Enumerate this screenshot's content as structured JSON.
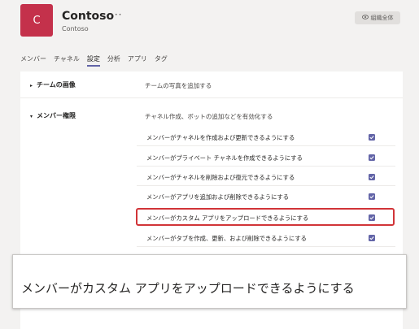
{
  "team": {
    "avatar_letter": "C",
    "name": "Contoso",
    "more": "···",
    "subtitle": "Contoso",
    "org_badge": "組織全体"
  },
  "tabs": [
    {
      "label": "メンバー",
      "active": false
    },
    {
      "label": "チャネル",
      "active": false
    },
    {
      "label": "設定",
      "active": true
    },
    {
      "label": "分析",
      "active": false
    },
    {
      "label": "アプリ",
      "active": false
    },
    {
      "label": "タグ",
      "active": false
    }
  ],
  "sections": [
    {
      "title": "チームの画像",
      "description": "チームの写真を追加する",
      "expanded": false
    },
    {
      "title": "メンバー権限",
      "description": "チャネル作成、ボットの追加などを有効化する",
      "expanded": true
    }
  ],
  "permissions": [
    {
      "label": "メンバーがチャネルを作成および更新できるようにする",
      "checked": true
    },
    {
      "label": "メンバーがプライベート チャネルを作成できるようにする",
      "checked": true
    },
    {
      "label": "メンバーがチャネルを削除および復元できるようにする",
      "checked": true
    },
    {
      "label": "メンバーがアプリを追加および削除できるようにする",
      "checked": true
    },
    {
      "label": "メンバーがカスタム アプリをアップロードできるようにする",
      "checked": true
    },
    {
      "label": "メンバーがタブを作成、更新、および削除できるようにする",
      "checked": true
    }
  ],
  "callout": {
    "text": "メンバーがカスタム アプリをアップロードできるようにする"
  },
  "colors": {
    "accent": "#6264a7",
    "avatar": "#c4314b",
    "highlight": "#d13438"
  }
}
